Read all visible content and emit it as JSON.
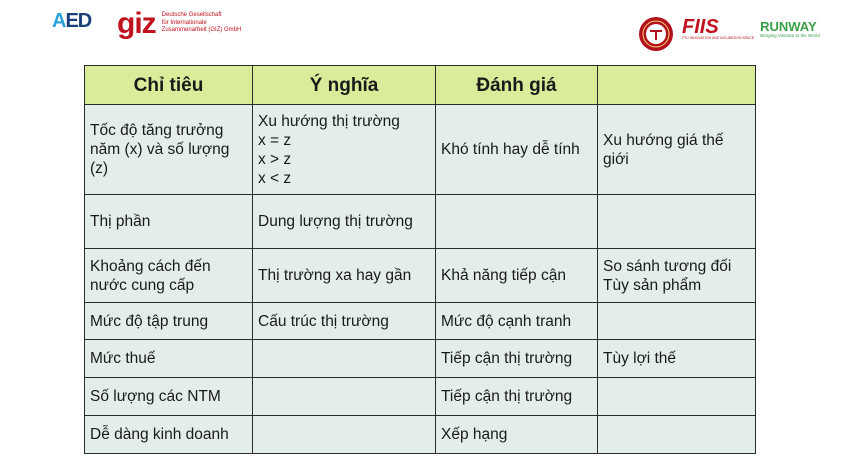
{
  "logos": {
    "aed": {
      "mark_a": "A",
      "mark_rest": "ED"
    },
    "giz": {
      "word": "giz",
      "description_lines": [
        "Deutsche Gesellschaft",
        "für Internationale",
        "Zusammenarbeit (GIZ) GmbH"
      ]
    },
    "fiis": {
      "word": "FIIS",
      "subtitle": "FTU INNOVATION AND INCUBATION SPACE"
    },
    "runway": {
      "word": "RUNWAY",
      "tagline": "Bringing Vietnam to the World"
    }
  },
  "table": {
    "headers": [
      "Chỉ tiêu",
      "Ý nghĩa",
      "Đánh giá",
      ""
    ],
    "rows": [
      {
        "criterion": [
          "Tốc độ tăng trưởng",
          "năm (x) và số lượng",
          "(z)"
        ],
        "meaning": [
          "Xu hướng thị trường",
          "x = z",
          "x > z",
          "x < z"
        ],
        "evaluation": [
          "Khó tính hay dễ tính"
        ],
        "note": [
          "Xu hướng giá thế",
          "giới"
        ]
      },
      {
        "criterion": [
          "Thị phần"
        ],
        "meaning": [
          "Dung lượng thị trường"
        ],
        "evaluation": [],
        "note": []
      },
      {
        "criterion": [
          "Khoảng cách đến",
          "nước cung cấp"
        ],
        "meaning": [
          "Thị trường xa hay gần"
        ],
        "evaluation": [
          "Khả năng tiếp cận"
        ],
        "note": [
          "So sánh tương đối",
          "Tùy sản phẩm"
        ]
      },
      {
        "criterion": [
          "Mức độ tập trung"
        ],
        "meaning": [
          "Cấu trúc thị trường"
        ],
        "evaluation": [
          "Mức độ cạnh tranh"
        ],
        "note": []
      },
      {
        "criterion": [
          "Mức thuế"
        ],
        "meaning": [],
        "evaluation": [
          "Tiếp cận thị trường"
        ],
        "note": [
          "Tùy lợi thế"
        ]
      },
      {
        "criterion": [
          "Số lượng các NTM"
        ],
        "meaning": [],
        "evaluation": [
          "Tiếp cận thị trường"
        ],
        "note": []
      },
      {
        "criterion": [
          "Dễ dàng kinh doanh"
        ],
        "meaning": [],
        "evaluation": [
          "Xếp hạng"
        ],
        "note": []
      }
    ]
  },
  "colors": {
    "header_bg": "#d9ec9a",
    "cell_bg": "#e3eee8",
    "brand_red": "#c1121f",
    "runway_green": "#3aa04a"
  }
}
